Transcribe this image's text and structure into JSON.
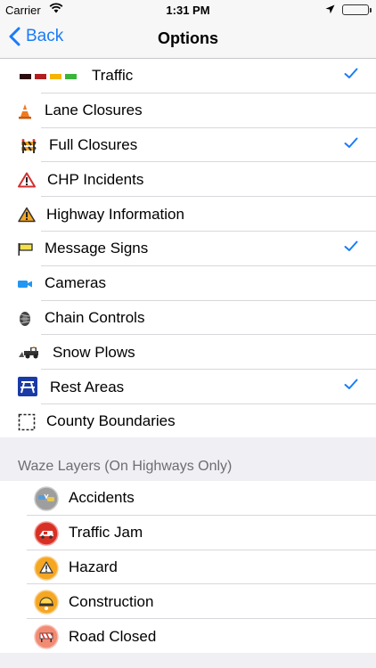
{
  "status_bar": {
    "carrier": "Carrier",
    "time": "1:31 PM",
    "battery_color": "#4cd964"
  },
  "nav": {
    "back_label": "Back",
    "title": "Options",
    "accent_color": "#1a7cf7"
  },
  "options": [
    {
      "label": "Traffic",
      "icon": "traffic-legend-icon",
      "checked": true
    },
    {
      "label": "Lane Closures",
      "icon": "traffic-cone-icon",
      "checked": false
    },
    {
      "label": "Full Closures",
      "icon": "road-barrier-icon",
      "checked": true
    },
    {
      "label": "CHP Incidents",
      "icon": "warning-triangle-red-icon",
      "checked": false
    },
    {
      "label": "Highway Information",
      "icon": "warning-triangle-orange-icon",
      "checked": false
    },
    {
      "label": "Message Signs",
      "icon": "message-sign-icon",
      "checked": true
    },
    {
      "label": "Cameras",
      "icon": "camera-icon",
      "checked": false
    },
    {
      "label": "Chain Controls",
      "icon": "tire-chain-icon",
      "checked": false
    },
    {
      "label": "Snow Plows",
      "icon": "snow-plow-icon",
      "checked": false
    },
    {
      "label": "Rest Areas",
      "icon": "picnic-table-icon",
      "checked": true
    },
    {
      "label": "County Boundaries",
      "icon": "dashed-square-icon",
      "checked": false
    }
  ],
  "waze": {
    "header": "Waze Layers (On Highways Only)",
    "items": [
      {
        "label": "Accidents",
        "icon": "waze-accident-icon"
      },
      {
        "label": "Traffic Jam",
        "icon": "waze-traffic-jam-icon"
      },
      {
        "label": "Hazard",
        "icon": "waze-hazard-icon"
      },
      {
        "label": "Construction",
        "icon": "waze-construction-icon"
      },
      {
        "label": "Road Closed",
        "icon": "waze-road-closed-icon"
      }
    ]
  }
}
